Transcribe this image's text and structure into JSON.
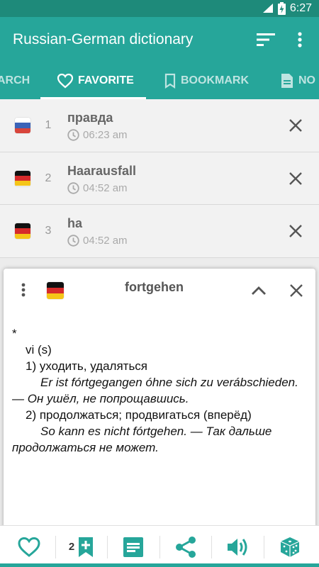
{
  "status_bar": {
    "time": "6:27",
    "icons": [
      "wifi-icon",
      "battery-charging-icon"
    ]
  },
  "app_bar": {
    "title": "Russian-German dictionary",
    "actions": [
      "sort-icon",
      "more-vert-icon"
    ]
  },
  "tabs": [
    {
      "label": "ARCH",
      "icon": "search-icon",
      "active": false
    },
    {
      "label": "FAVORITE",
      "icon": "heart-icon",
      "active": true
    },
    {
      "label": "BOOKMARK",
      "icon": "bookmark-icon",
      "active": false
    },
    {
      "label": "NO",
      "icon": "note-icon",
      "active": false
    }
  ],
  "favorites": [
    {
      "num": "1",
      "word": "правда",
      "time": "06:23 am",
      "lang": "ru"
    },
    {
      "num": "2",
      "word": "Haarausfall",
      "time": "04:52 am",
      "lang": "de"
    },
    {
      "num": "3",
      "word": "ha",
      "time": "04:52 am",
      "lang": "de"
    }
  ],
  "card": {
    "word": "fortgehen",
    "lang": "de",
    "entry": {
      "star": "*",
      "grammar": "vi (s)",
      "sense1": "1) уходить, удаляться",
      "example1": "Er ist fórtgegangen óhne sich zu verábschieden. — Он ушёл, не попрощавшись.",
      "sense2": "2) продолжаться; продвигаться (вперёд)",
      "example2": "So kann es nicht fórtgehen. — Так дальше продолжаться не может."
    }
  },
  "bottom_bar": {
    "bookmark_count": "2",
    "buttons": [
      "heart-icon",
      "bookmark-add-icon",
      "note-icon",
      "share-icon",
      "volume-icon",
      "dice-icon"
    ]
  },
  "colors": {
    "primary": "#26a69a",
    "primary_dark": "#1e8a7a",
    "icon_teal": "#26a69a"
  }
}
